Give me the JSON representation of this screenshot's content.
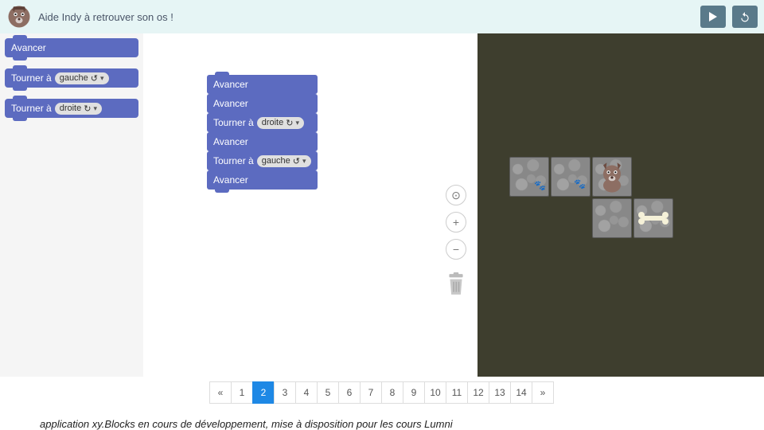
{
  "header": {
    "title": "Aide Indy à retrouver son os !"
  },
  "palette": [
    {
      "label": "Avancer"
    },
    {
      "label": "Tourner à",
      "param": "gauche"
    },
    {
      "label": "Tourner à",
      "param": "droite"
    }
  ],
  "workspace": {
    "stack": [
      {
        "label": "Avancer"
      },
      {
        "label": "Avancer"
      },
      {
        "label": "Tourner à",
        "param": "droite"
      },
      {
        "label": "Avancer"
      },
      {
        "label": "Tourner à",
        "param": "gauche"
      },
      {
        "label": "Avancer"
      }
    ]
  },
  "pagination": {
    "prev": "«",
    "next": "»",
    "pages": [
      "1",
      "2",
      "3",
      "4",
      "5",
      "6",
      "7",
      "8",
      "9",
      "10",
      "11",
      "12",
      "13",
      "14"
    ],
    "active": 2
  },
  "caption": "application xy.Blocks en cours de développement, mise à disposition pour les cours Lumni",
  "colors": {
    "block": "#5c6bc0",
    "headerBg": "#e6f5f5",
    "stageBg": "#3e3e2e",
    "btn": "#5a7a8a",
    "active": "#1e88e5"
  }
}
